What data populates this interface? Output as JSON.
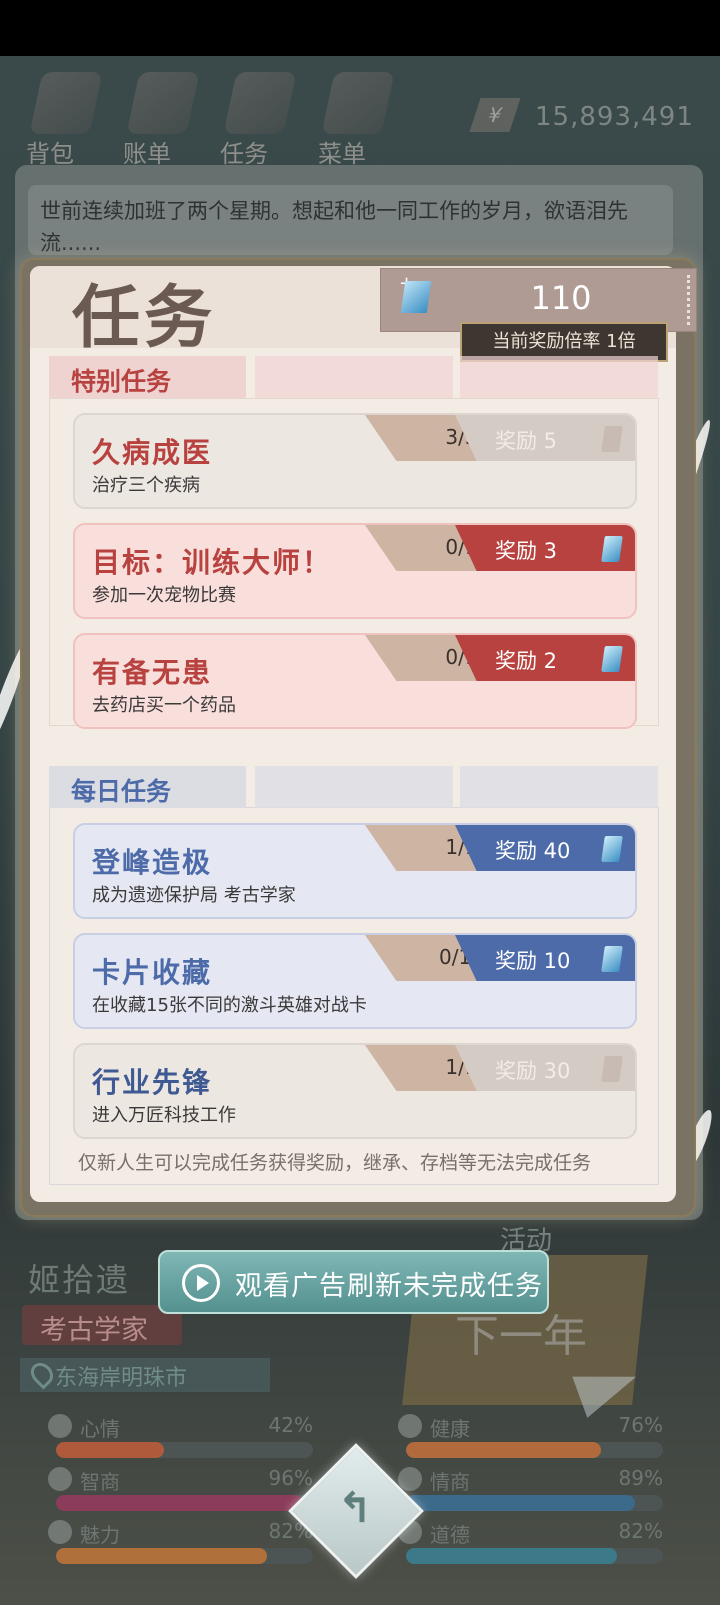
{
  "nav": [
    {
      "label": "背包",
      "icon": "backpack-icon"
    },
    {
      "label": "账单",
      "icon": "bill-icon"
    },
    {
      "label": "任务",
      "icon": "task-icon"
    },
    {
      "label": "菜单",
      "icon": "menu-icon"
    }
  ],
  "money": {
    "symbol": "¥",
    "value": "15,893,491"
  },
  "story_text": "世前连续加班了两个星期。想起和他一同工作的岁月，欲语泪先流......",
  "panel": {
    "title": "任务",
    "points": "110",
    "multiplier": "当前奖励倍率 1倍",
    "special_label": "特别任务",
    "daily_label": "每日任务",
    "footnote": "仅新人生可以完成任务获得奖励，继承、存档等无法完成任务"
  },
  "special_tasks": [
    {
      "title": "久病成医",
      "desc": "治疗三个疾病",
      "progress": "3/3",
      "reward": "奖励 5",
      "state": "done"
    },
    {
      "title": "目标：训练大师！",
      "desc": "参加一次宠物比赛",
      "progress": "0/1",
      "reward": "奖励 3",
      "state": "active"
    },
    {
      "title": "有备无患",
      "desc": "去药店买一个药品",
      "progress": "0/1",
      "reward": "奖励 2",
      "state": "active"
    }
  ],
  "daily_tasks": [
    {
      "title": "登峰造极",
      "desc": "成为遗迹保护局 考古学家",
      "progress": "1/1",
      "reward": "奖励 40",
      "state": "claim"
    },
    {
      "title": "卡片收藏",
      "desc": "在收藏15张不同的激斗英雄对战卡",
      "progress": "0/15",
      "reward": "奖励 10",
      "state": "claim"
    },
    {
      "title": "行业先锋",
      "desc": "进入万匠科技工作",
      "progress": "1/1",
      "reward": "奖励 30",
      "state": "done"
    }
  ],
  "ad_button": "观看广告刷新未完成任务",
  "character": {
    "name": "姬拾遗",
    "job": "考古学家",
    "location": "东海岸明珠市"
  },
  "next_year": "下一年",
  "activity": "活动",
  "stats": [
    {
      "label": "心情",
      "value": "42%",
      "fraction": 0.42,
      "color": "#b05a3c"
    },
    {
      "label": "健康",
      "value": "76%",
      "fraction": 0.76,
      "color": "#b06a3c"
    },
    {
      "label": "智商",
      "value": "96%",
      "fraction": 0.96,
      "color": "#8a3c5a"
    },
    {
      "label": "情商",
      "value": "89%",
      "fraction": 0.89,
      "color": "#3c6a8a"
    },
    {
      "label": "魅力",
      "value": "82%",
      "fraction": 0.82,
      "color": "#b0703c"
    },
    {
      "label": "道德",
      "value": "82%",
      "fraction": 0.82,
      "color": "#3c7a8a"
    }
  ],
  "colors": {
    "special_bg": "#f9dfdc",
    "special_accent": "#b8423f",
    "daily_bg": "#e5e8f3",
    "daily_accent": "#4d6ba9",
    "done_bg": "#ede7e2",
    "done_reward": "#d5cbc5",
    "progress_bg": "#cdb4a3"
  }
}
